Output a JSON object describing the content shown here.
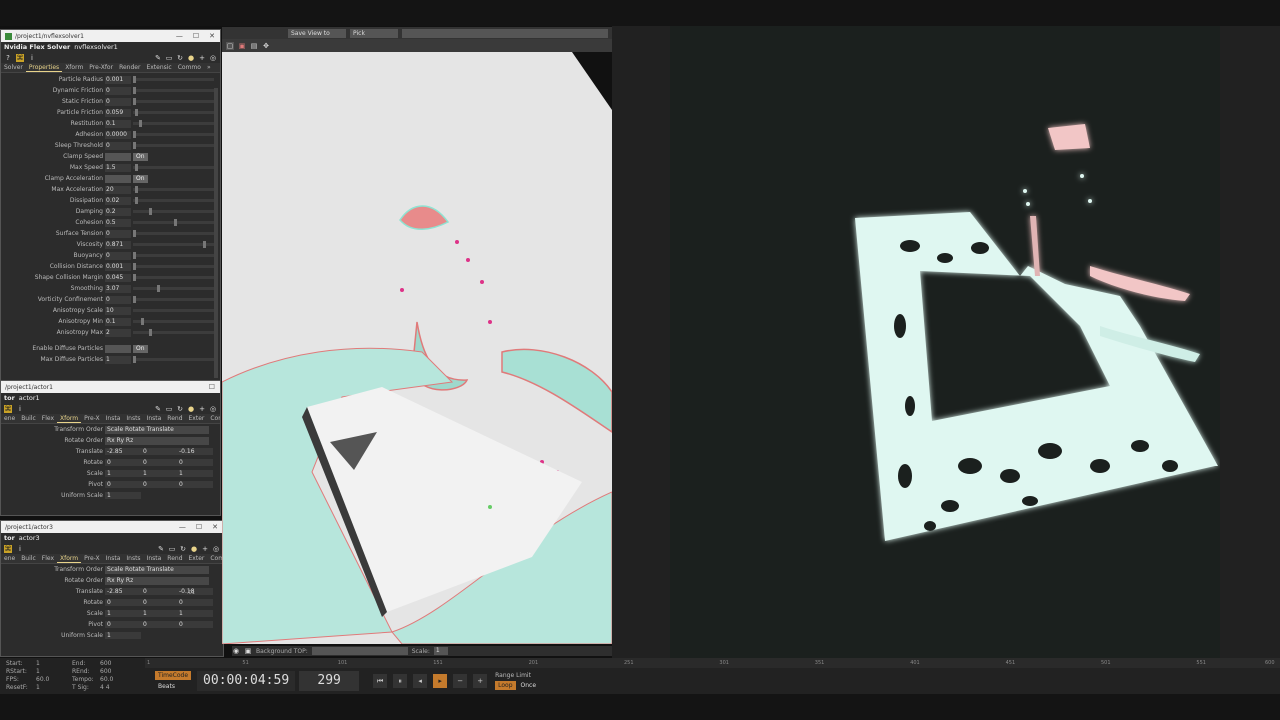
{
  "solver_window": {
    "path": "/project1/nvflexsolver1",
    "op_type": "Nvidia Flex Solver",
    "op_name": "nvflexsolver1",
    "tabs": [
      "Solver",
      "Properties",
      "Xform",
      "Pre-Xfor",
      "Render",
      "Extensic",
      "Commo"
    ],
    "active_tab": "Properties",
    "params": [
      {
        "label": "Particle Radius",
        "value": "0.001",
        "kind": "slider",
        "level": 0.0
      },
      {
        "label": "Dynamic Friction",
        "value": "0",
        "kind": "slider",
        "level": 0.0
      },
      {
        "label": "Static Friction",
        "value": "0",
        "kind": "slider",
        "level": 0.0
      },
      {
        "label": "Particle Friction",
        "value": "0.059",
        "kind": "slider",
        "level": 0.03
      },
      {
        "label": "Restitution",
        "value": "0.1",
        "kind": "slider",
        "level": 0.08
      },
      {
        "label": "Adhesion",
        "value": "0.0000",
        "kind": "slider",
        "level": 0.0
      },
      {
        "label": "Sleep Threshold",
        "value": "0",
        "kind": "slider",
        "level": 0.0
      },
      {
        "label": "Clamp Speed",
        "value": "On",
        "kind": "toggle"
      },
      {
        "label": "Max Speed",
        "value": "1.5",
        "kind": "slider",
        "level": 0.02
      },
      {
        "label": "Clamp Acceleration",
        "value": "On",
        "kind": "toggle"
      },
      {
        "label": "Max Acceleration",
        "value": "20",
        "kind": "slider",
        "level": 0.02
      },
      {
        "label": "Dissipation",
        "value": "0.02",
        "kind": "slider",
        "level": 0.02
      },
      {
        "label": "Damping",
        "value": "0.2",
        "kind": "slider",
        "level": 0.2
      },
      {
        "label": "Cohesion",
        "value": "0.5",
        "kind": "slider",
        "level": 0.5
      },
      {
        "label": "Surface Tension",
        "value": "0",
        "kind": "slider",
        "level": 0.0
      },
      {
        "label": "Viscosity",
        "value": "0.871",
        "kind": "slider",
        "level": 0.87
      },
      {
        "label": "Buoyancy",
        "value": "0",
        "kind": "slider",
        "level": 0.0
      },
      {
        "label": "Collision Distance",
        "value": "0.001",
        "kind": "slider",
        "level": 0.0
      },
      {
        "label": "Shape Collision Margin",
        "value": "0.045",
        "kind": "slider",
        "level": 0.0
      },
      {
        "label": "Smoothing",
        "value": "3.07",
        "kind": "slider",
        "level": 0.3
      },
      {
        "label": "Vorticity Confinement",
        "value": "0",
        "kind": "slider",
        "level": 0.0
      },
      {
        "label": "Anisotropy Scale",
        "value": "10",
        "kind": "slider",
        "level": 1.0
      },
      {
        "label": "Anisotropy Min",
        "value": "0.1",
        "kind": "slider",
        "level": 0.1
      },
      {
        "label": "Anisotropy Max",
        "value": "2",
        "kind": "slider",
        "level": 0.2
      },
      {
        "label": "",
        "value": "",
        "kind": "spacer"
      },
      {
        "label": "Enable Diffuse Particles",
        "value": "On",
        "kind": "toggle"
      },
      {
        "label": "Max Diffuse Particles",
        "value": "1",
        "kind": "slider",
        "level": 0.0
      }
    ]
  },
  "actor1_window": {
    "path": "/project1/actor1",
    "op_type": "tor",
    "op_name": "actor1",
    "tabs": [
      "ene",
      "Builc",
      "Flex",
      "Xform",
      "Pre-X",
      "Insta",
      "Insts",
      "Insta",
      "Rend",
      "Exter",
      "Comi"
    ],
    "active_tab": "Xform",
    "transform_order": "Scale Rotate Translate",
    "rotate_order": "Rx Ry Rz",
    "rows": [
      {
        "label": "Translate",
        "values": [
          "-2.85",
          "0",
          "-0.16"
        ]
      },
      {
        "label": "Rotate",
        "values": [
          "0",
          "0",
          "0"
        ]
      },
      {
        "label": "Scale",
        "values": [
          "1",
          "1",
          "1"
        ]
      },
      {
        "label": "Pivot",
        "values": [
          "0",
          "0",
          "0"
        ]
      },
      {
        "label": "Uniform Scale",
        "values": [
          "1",
          "",
          ""
        ]
      }
    ],
    "labels": {
      "transform_order": "Transform Order",
      "rotate_order": "Rotate Order"
    }
  },
  "actor3_window": {
    "path": "/project1/actor3",
    "op_type": "tor",
    "op_name": "actor3",
    "tabs": [
      "ene",
      "Builc",
      "Flex",
      "Xform",
      "Pre-X",
      "Insta",
      "Insts",
      "Insta",
      "Rend",
      "Exter",
      "Comi"
    ],
    "active_tab": "Xform",
    "transform_order": "Scale Rotate Translate",
    "rotate_order": "Rx Ry Rz",
    "tooltip_value": ".01",
    "rows": [
      {
        "label": "Translate",
        "values": [
          "-2.85",
          "0",
          "-0.18"
        ]
      },
      {
        "label": "Rotate",
        "values": [
          "0",
          "0",
          "0"
        ]
      },
      {
        "label": "Scale",
        "values": [
          "1",
          "1",
          "1"
        ]
      },
      {
        "label": "Pivot",
        "values": [
          "0",
          "0",
          "0"
        ]
      },
      {
        "label": "Uniform Scale",
        "values": [
          "1",
          "",
          ""
        ]
      }
    ],
    "labels": {
      "transform_order": "Transform Order",
      "rotate_order": "Rotate Order"
    }
  },
  "viewport": {
    "save_view_label": "Save View to",
    "pick_label": "Pick",
    "background_top_label": "Background TOP:",
    "scale_label": "Scale:",
    "scale_value": "1"
  },
  "timeline": {
    "info_left": [
      {
        "k": "Start:",
        "v": "1"
      },
      {
        "k": "RStart:",
        "v": "1"
      },
      {
        "k": "FPS:",
        "v": "60.0"
      },
      {
        "k": "ResetF:",
        "v": "1"
      }
    ],
    "info_right": [
      {
        "k": "End:",
        "v": "600"
      },
      {
        "k": "REnd:",
        "v": "600"
      },
      {
        "k": "Tempo:",
        "v": "60.0"
      },
      {
        "k": "T Sig:",
        "v": "4   4"
      }
    ],
    "ruler_ticks": [
      "1",
      "51",
      "101",
      "151",
      "201",
      "251",
      "301",
      "351",
      "401",
      "451",
      "501",
      "551",
      "600"
    ],
    "timecode_label": "TimeCode",
    "beats_label": "Beats",
    "timecode": "00:00:04:59",
    "frame": "299",
    "range_limit_label": "Range Limit",
    "loop_label": "Loop",
    "once_label": "Once"
  },
  "colors": {
    "accent": "#c47a2c",
    "active_tab": "#e8d38a",
    "fluid_cyan": "#8fe3d2",
    "fluid_red": "#e07a7a"
  }
}
